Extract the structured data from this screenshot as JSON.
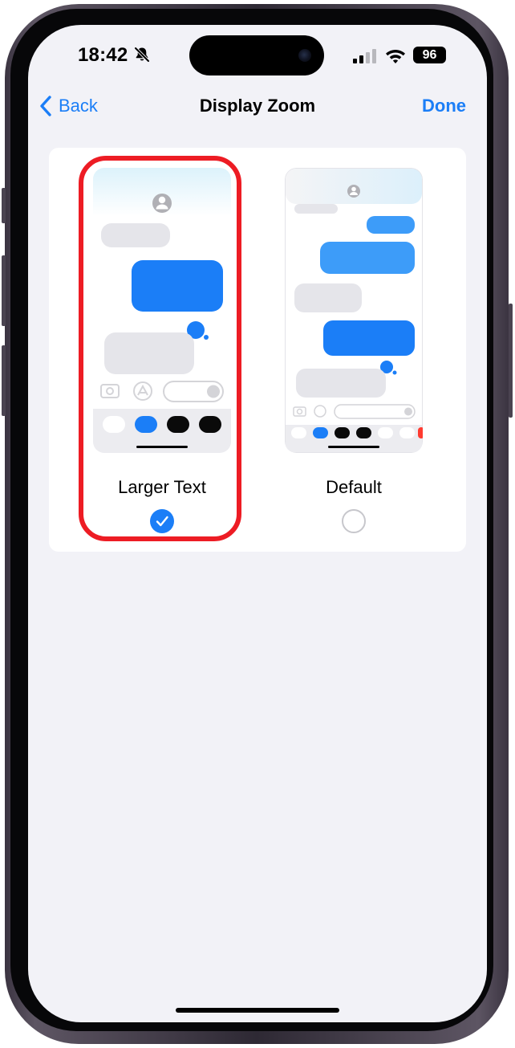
{
  "status_bar": {
    "time": "18:42",
    "battery": "96"
  },
  "nav": {
    "back_label": "Back",
    "title": "Display Zoom",
    "done_label": "Done"
  },
  "options": [
    {
      "label": "Larger Text",
      "selected": true
    },
    {
      "label": "Default",
      "selected": false
    }
  ],
  "colors": {
    "accent": "#1b7ef7",
    "highlight": "#ed1c24",
    "background": "#f2f2f7"
  }
}
